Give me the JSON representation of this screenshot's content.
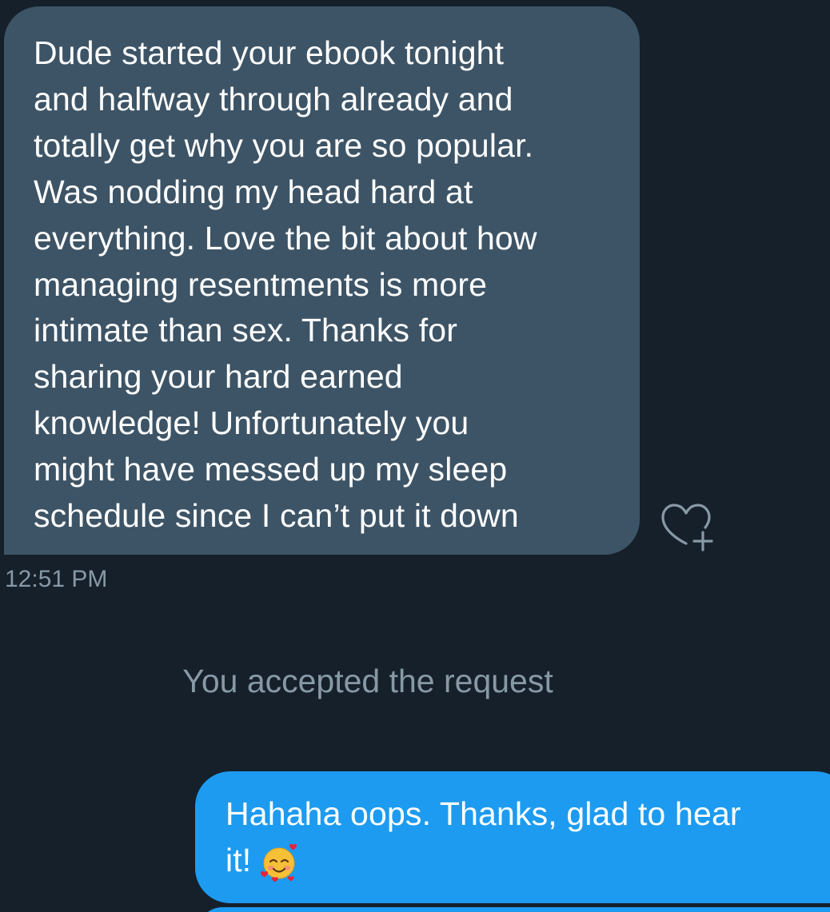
{
  "conversation": {
    "incoming_message": {
      "lines": [
        "Dude started your ebook tonight",
        "and halfway through already and",
        "totally get why you are so popular.",
        "Was nodding my head hard at",
        "everything. Love the bit about how",
        "managing resentments is more",
        "intimate than sex. Thanks for",
        "sharing your hard earned",
        "knowledge! Unfortunately you",
        "might have messed up my sleep",
        "schedule since I can’t put it down"
      ],
      "timestamp": "12:51 PM",
      "react_icon": "heart-plus-icon"
    },
    "system_message": "You accepted the request",
    "outgoing_message": {
      "lines": [
        "Hahaha oops. Thanks, glad to hear",
        "it!"
      ],
      "emoji": "smiling-face-with-hearts-icon"
    }
  },
  "colors": {
    "background": "#15202b",
    "incoming_bubble": "#3d5466",
    "outgoing_bubble": "#1d9bf0",
    "muted_text": "#8899a6",
    "text": "#ffffff"
  }
}
